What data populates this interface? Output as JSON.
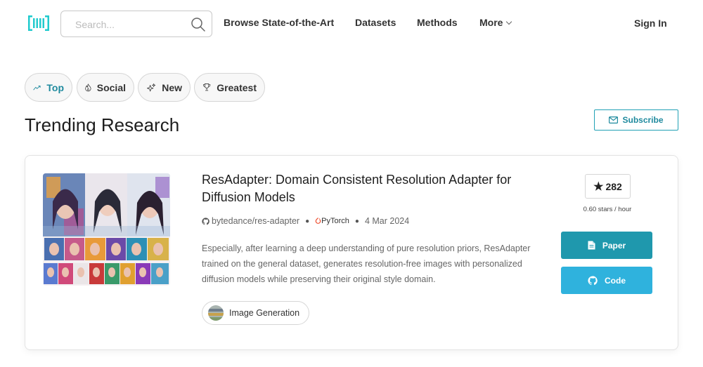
{
  "header": {
    "logo_icon": "papers-with-code-logo",
    "search": {
      "placeholder": "Search...",
      "value": ""
    },
    "nav": {
      "browse": "Browse State-of-the-Art",
      "datasets": "Datasets",
      "methods": "Methods",
      "more": "More"
    },
    "sign_in": "Sign In"
  },
  "filters": [
    {
      "label": "Top",
      "icon": "trending-up-icon",
      "active": true
    },
    {
      "label": "Social",
      "icon": "flame-icon",
      "active": false
    },
    {
      "label": "New",
      "icon": "sparkles-icon",
      "active": false
    },
    {
      "label": "Greatest",
      "icon": "trophy-icon",
      "active": false
    }
  ],
  "page_title": "Trending Research",
  "subscribe_label": "Subscribe",
  "paper": {
    "title": "ResAdapter: Domain Consistent Resolution Adapter for Diffusion Models",
    "repo": "bytedance/res-adapter",
    "framework": "PyTorch",
    "date": "4 Mar 2024",
    "abstract": "Especially, after learning a deep understanding of pure resolution priors, ResAdapter trained on the general dataset, generates resolution-free images with personalized diffusion models while preserving their original style domain.",
    "task": "Image Generation",
    "stars": "282",
    "stars_rate": "0.60 stars / hour",
    "paper_label": "Paper",
    "code_label": "Code"
  },
  "colors": {
    "accent": "#21a1b5",
    "paper_button": "#1f98ad",
    "code_button": "#2fb2dd"
  }
}
